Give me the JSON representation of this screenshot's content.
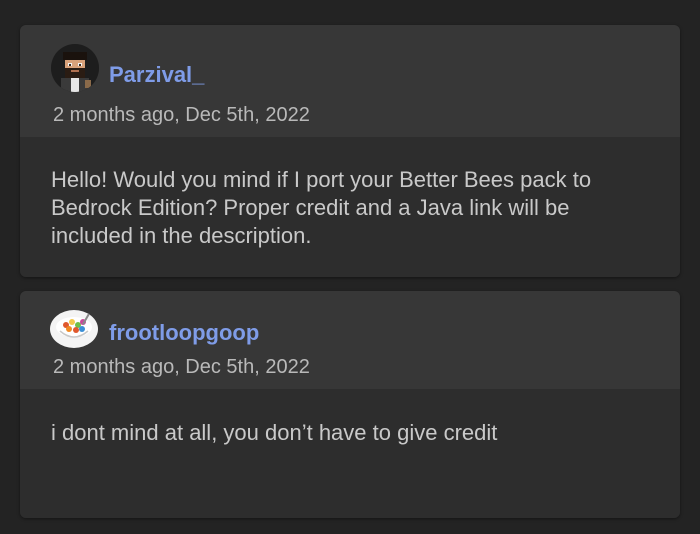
{
  "comments": [
    {
      "username": "Parzival_",
      "timestamp": "2 months ago, Dec 5th, 2022",
      "text": "Hello! Would you mind if I port your Better Bees pack to Bedrock Edition? Proper credit and a Java link will be included in the description.",
      "avatar_icon": "pixel-character-avatar-icon"
    },
    {
      "username": "frootloopgoop",
      "timestamp": "2 months ago, Dec 5th, 2022",
      "text": "i dont mind at all, you don’t have to give credit",
      "avatar_icon": "cereal-bowl-avatar-icon"
    }
  ],
  "colors": {
    "page_background": "#232323",
    "header_background": "#373737",
    "body_background": "#2d2d2d",
    "username": "#7f9ce8",
    "timestamp": "#b9b9b9",
    "text": "#c9c9c9"
  }
}
